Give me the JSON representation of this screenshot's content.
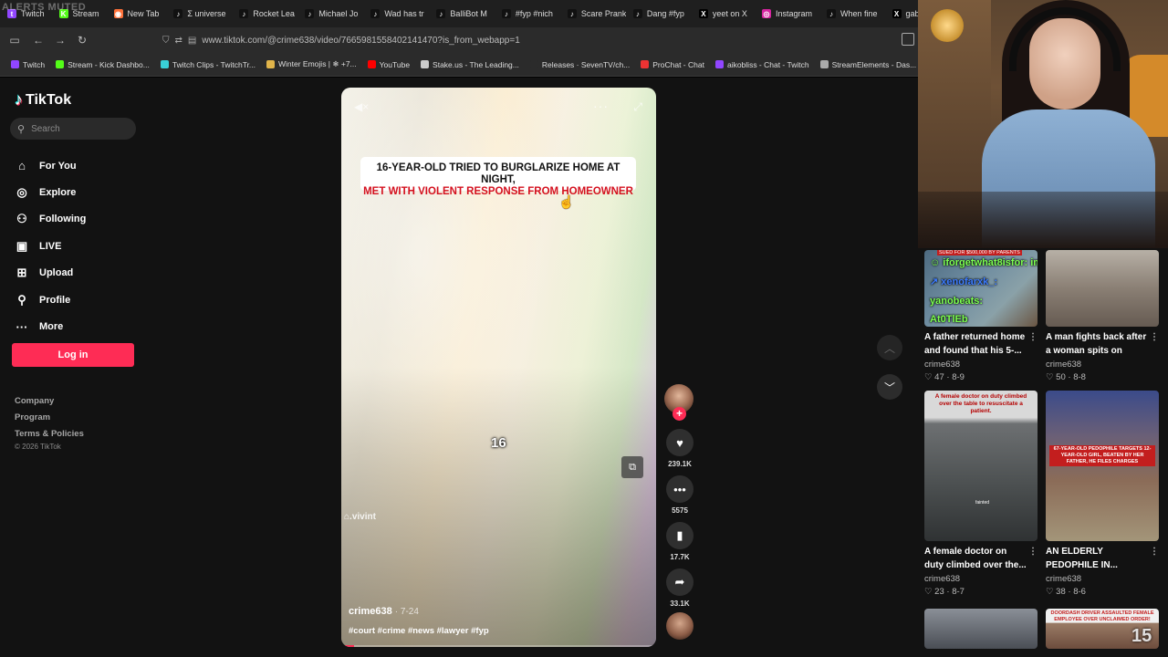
{
  "browser": {
    "tabs": [
      {
        "label": "Twitch",
        "color": "#9146ff",
        "glyph": "t"
      },
      {
        "label": "Stream",
        "color": "#53fc18",
        "glyph": "K"
      },
      {
        "label": "New Tab",
        "color": "#ff7139",
        "glyph": "◉"
      },
      {
        "label": "Σ universe",
        "color": "#111111",
        "glyph": "♪"
      },
      {
        "label": "Rocket Lea",
        "color": "#111111",
        "glyph": "♪"
      },
      {
        "label": "Michael Jo",
        "color": "#111111",
        "glyph": "♪"
      },
      {
        "label": "Wad has tr",
        "color": "#111111",
        "glyph": "♪"
      },
      {
        "label": "BalliBot M",
        "color": "#111111",
        "glyph": "♪"
      },
      {
        "label": "#fyp #nich",
        "color": "#111111",
        "glyph": "♪"
      },
      {
        "label": "Scare Prank",
        "color": "#111111",
        "glyph": "♪"
      },
      {
        "label": "Dang #fyp",
        "color": "#111111",
        "glyph": "♪"
      },
      {
        "label": "yeet on X",
        "color": "#000000",
        "glyph": "X"
      },
      {
        "label": "Instagram",
        "color": "#d6249f",
        "glyph": "◎"
      },
      {
        "label": "When fine",
        "color": "#111111",
        "glyph": "♪"
      },
      {
        "label": "gab",
        "color": "#000000",
        "glyph": "X"
      }
    ],
    "overlay_text": "ALERTS MUTED",
    "url": "www.tiktok.com/@crime638/video/7665981558402141470?is_from_webapp=1",
    "bookmarks": [
      {
        "label": "Twitch",
        "color": "#9146ff"
      },
      {
        "label": "Stream - Kick Dashbo...",
        "color": "#53fc18"
      },
      {
        "label": "Twitch Clips - TwitchTr...",
        "color": "#39d0d8"
      },
      {
        "label": "Winter Emojis | ❄ +7...",
        "color": "#e0b44a"
      },
      {
        "label": "YouTube",
        "color": "#ff0000"
      },
      {
        "label": "Stake.us - The Leading...",
        "color": "#cccccc"
      },
      {
        "label": "Releases · SevenTV/ch...",
        "color": "#2b2b2b"
      },
      {
        "label": "ProChat - Chat",
        "color": "#e33"
      },
      {
        "label": "aikobliss - Chat - Twitch",
        "color": "#9146ff"
      },
      {
        "label": "StreamElements - Das...",
        "color": "#aaaaaa"
      }
    ]
  },
  "sidebar": {
    "logo": "TikTok",
    "search_placeholder": "Search",
    "menu": [
      {
        "label": "For You",
        "icon": "home-icon",
        "glyph": "⌂"
      },
      {
        "label": "Explore",
        "icon": "compass-icon",
        "glyph": "◎"
      },
      {
        "label": "Following",
        "icon": "person-icon",
        "glyph": "⚇"
      },
      {
        "label": "LIVE",
        "icon": "live-icon",
        "glyph": "▣"
      },
      {
        "label": "Upload",
        "icon": "upload-icon",
        "glyph": "⊞"
      },
      {
        "label": "Profile",
        "icon": "profile-icon",
        "glyph": "⚲"
      },
      {
        "label": "More",
        "icon": "more-icon",
        "glyph": "···"
      }
    ],
    "login_label": "Log in",
    "footer": [
      "Company",
      "Program",
      "Terms & Policies"
    ],
    "copyright": "© 2026 TikTok"
  },
  "video": {
    "headline_line1": "16-YEAR-OLD TRIED TO BURGLARIZE HOME AT NIGHT,",
    "headline_line2": "MET WITH VIOLENT RESPONSE FROM HOMEOWNER",
    "counter": "16",
    "watermark": "⌂.vivint",
    "author": "crime638",
    "date": "· 7-24",
    "tags": "#court #crime #news #lawyer #fyp",
    "progress": 0.04
  },
  "actions": {
    "likes": "239.1K",
    "comments": "5575",
    "saves": "17.7K",
    "shares": "33.1K"
  },
  "recommended": [
    {
      "title": "A father returned home and found that his 5-...",
      "author": "crime638",
      "likes": "47",
      "date": "8-9"
    },
    {
      "title": "A man fights back after a woman spits on him...",
      "author": "crime638",
      "likes": "50",
      "date": "8-8"
    },
    {
      "title": "A female doctor on duty climbed over the...",
      "author": "crime638",
      "likes": "23",
      "date": "8-7"
    },
    {
      "title": "AN ELDERLY PEDOPHILE IN...",
      "author": "crime638",
      "likes": "38",
      "date": "8-6"
    }
  ],
  "thumb_text": {
    "t1_label": "SUED FOR $500,000 BY PARENTS",
    "chat_lines": [
      {
        "text": "☺ iforgetwhat8isfor: im in",
        "color": "#7cff4f"
      },
      {
        "text": "↗ xenofarxk_:",
        "color": "#3b7bff"
      },
      {
        "text": "yanobeats:",
        "color": "#7cff4f"
      },
      {
        "text": "At0TlEb",
        "color": "#7cff4f"
      }
    ],
    "t3_caption": "A female doctor on duty climbed over the table to resuscitate a patient.",
    "t3_fainted": "fainted",
    "t4_caption": "67-YEAR-OLD PEDOPHILE TARGETS 12-YEAR-OLD GIRL, BEATEN BY HER FATHER, HE FILES CHARGES",
    "t6_caption": "DOORDASH DRIVER ASSAULTED FEMALE EMPLOYEE OVER UNCLAIMED ORDER!",
    "overlay_number": "15"
  },
  "colors": {
    "accent": "#fe2c55",
    "page_bg": "#121212",
    "headline_red": "#d4101e"
  }
}
